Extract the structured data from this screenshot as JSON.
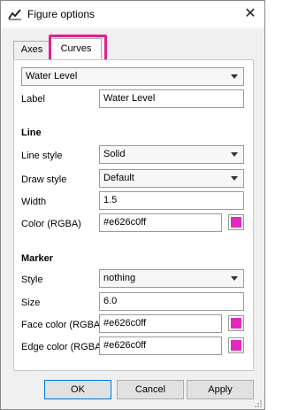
{
  "window": {
    "title": "Figure options"
  },
  "tabs": [
    {
      "label": "Axes",
      "selected": false
    },
    {
      "label": "Curves",
      "selected": true
    }
  ],
  "curve_selector": {
    "value": "Water Level"
  },
  "label_field": {
    "label": "Label",
    "value": "Water Level"
  },
  "line": {
    "section_title": "Line",
    "line_style": {
      "label": "Line style",
      "value": "Solid"
    },
    "draw_style": {
      "label": "Draw style",
      "value": "Default"
    },
    "width": {
      "label": "Width",
      "value": "1.5"
    },
    "color": {
      "label": "Color (RGBA)",
      "value": "#e626c0ff",
      "swatch": "#e626c0"
    }
  },
  "marker": {
    "section_title": "Marker",
    "style": {
      "label": "Style",
      "value": "nothing"
    },
    "size": {
      "label": "Size",
      "value": "6.0"
    },
    "face_color": {
      "label": "Face color (RGBA)",
      "value": "#e626c0ff",
      "swatch": "#e626c0"
    },
    "edge_color": {
      "label": "Edge color (RGBA)",
      "value": "#e626c0ff",
      "swatch": "#e626c0"
    }
  },
  "buttons": {
    "ok": "OK",
    "cancel": "Cancel",
    "apply": "Apply"
  },
  "colors": {
    "highlight": "#e1218d",
    "ok_border": "#0078d7"
  },
  "icons": {
    "app": "chart-line-icon",
    "close": "close-icon",
    "dropdown": "chevron-down-icon"
  }
}
